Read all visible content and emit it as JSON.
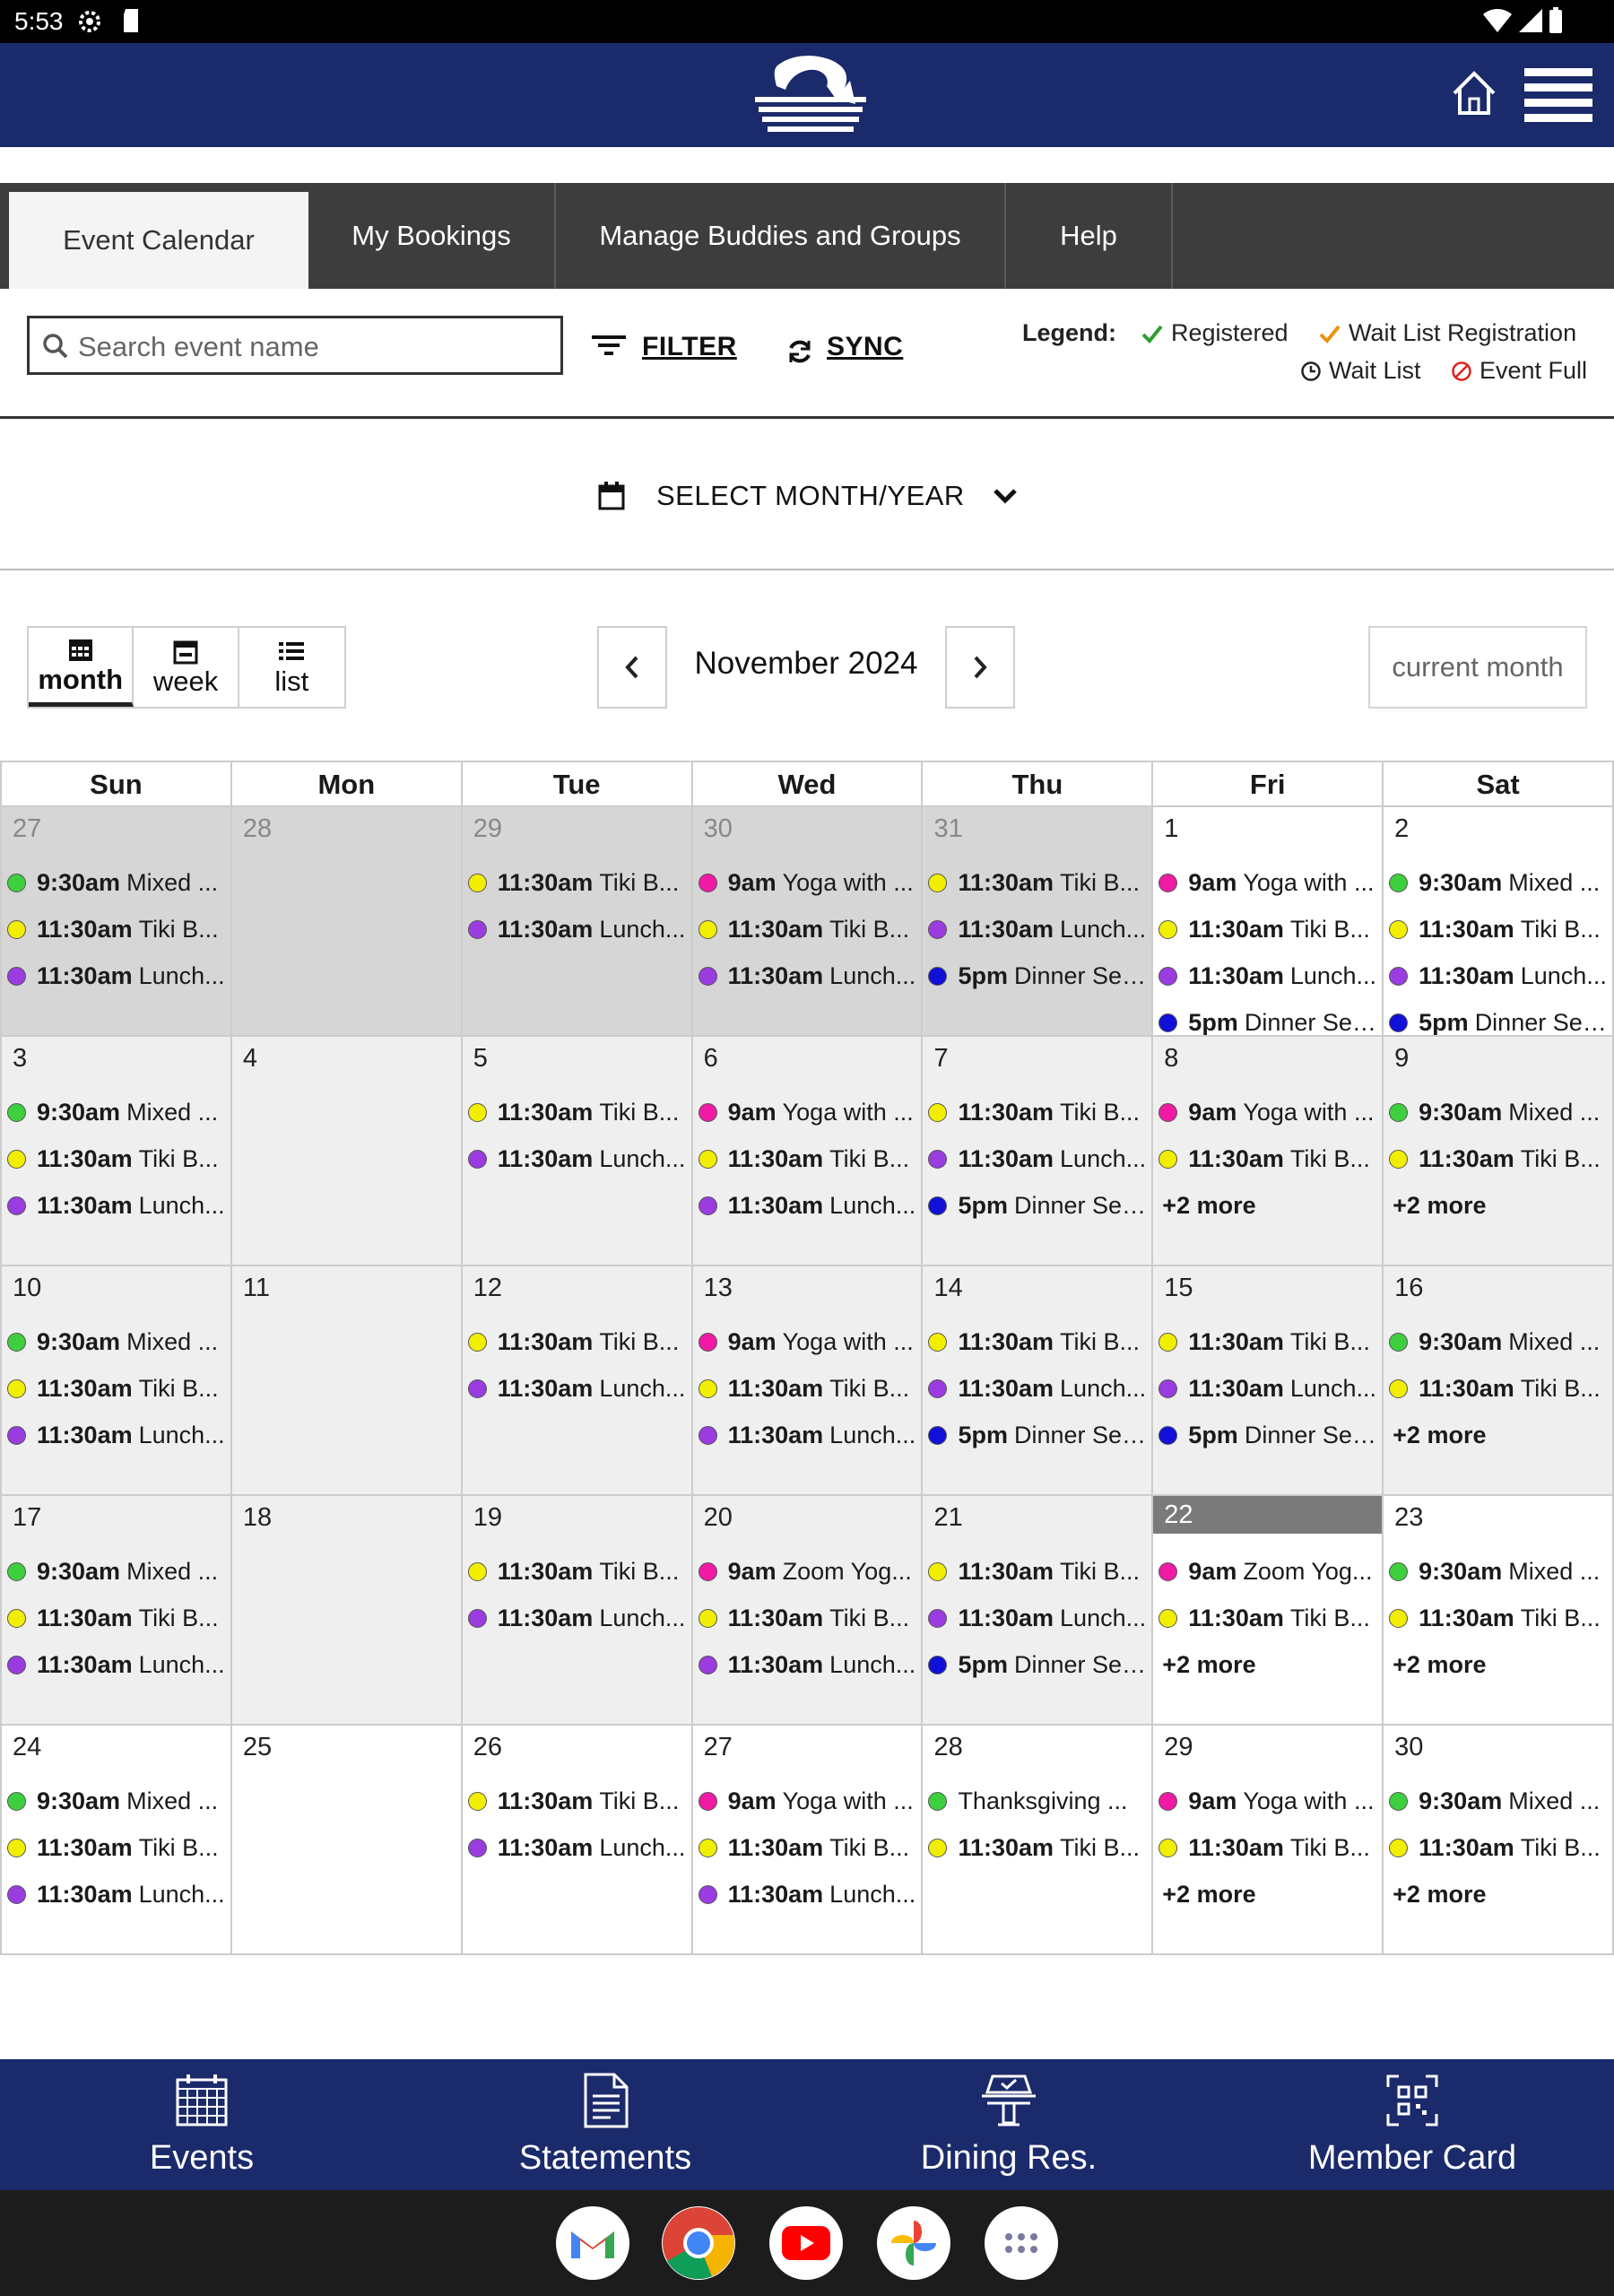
{
  "statusbar": {
    "time": "5:53"
  },
  "colors": {
    "header_bg": "#1b2a6b",
    "tabs_bg": "#3d3d3d",
    "registered": "#2e9e2e",
    "waitlist_reg": "#e89410",
    "event_full": "#e02020"
  },
  "tabs": [
    {
      "label": "Event Calendar",
      "active": true
    },
    {
      "label": "My Bookings"
    },
    {
      "label": "Manage Buddies and Groups"
    },
    {
      "label": "Help"
    }
  ],
  "search": {
    "placeholder": "Search event name"
  },
  "toolbar": {
    "filter_label": "FILTER",
    "sync_label": "SYNC"
  },
  "legend": {
    "label": "Legend:",
    "registered": "Registered",
    "waitlist_registration": "Wait List Registration",
    "waitlist": "Wait List",
    "event_full": "Event Full"
  },
  "select_month": {
    "label": "SELECT MONTH/YEAR"
  },
  "views": {
    "month": "month",
    "week": "week",
    "list": "list"
  },
  "calendar": {
    "title": "November 2024",
    "current_month_label": "current month",
    "weekday_headers": [
      "Sun",
      "Mon",
      "Tue",
      "Wed",
      "Thu",
      "Fri",
      "Sat"
    ],
    "weeks": [
      [
        {
          "day": "27",
          "other": true,
          "events": [
            {
              "c": "#3ecf3e",
              "t": "9:30am",
              "n": "Mixed ..."
            },
            {
              "c": "#f2ee00",
              "t": "11:30am",
              "n": "Tiki B..."
            },
            {
              "c": "#9a3ce0",
              "t": "11:30am",
              "n": "Lunch..."
            }
          ]
        },
        {
          "day": "28",
          "other": true,
          "events": []
        },
        {
          "day": "29",
          "other": true,
          "events": [
            {
              "c": "#f2ee00",
              "t": "11:30am",
              "n": "Tiki B..."
            },
            {
              "c": "#9a3ce0",
              "t": "11:30am",
              "n": "Lunch..."
            }
          ]
        },
        {
          "day": "30",
          "other": true,
          "events": [
            {
              "c": "#f01aa5",
              "t": "9am",
              "n": "Yoga with ..."
            },
            {
              "c": "#f2ee00",
              "t": "11:30am",
              "n": "Tiki B..."
            },
            {
              "c": "#9a3ce0",
              "t": "11:30am",
              "n": "Lunch..."
            }
          ]
        },
        {
          "day": "31",
          "other": true,
          "events": [
            {
              "c": "#f2ee00",
              "t": "11:30am",
              "n": "Tiki B..."
            },
            {
              "c": "#9a3ce0",
              "t": "11:30am",
              "n": "Lunch..."
            },
            {
              "c": "#1010d8",
              "t": "5pm",
              "n": "Dinner Ser..."
            }
          ]
        },
        {
          "day": "1",
          "future": true,
          "events": [
            {
              "c": "#f01aa5",
              "t": "9am",
              "n": "Yoga with ..."
            },
            {
              "c": "#f2ee00",
              "t": "11:30am",
              "n": "Tiki B..."
            },
            {
              "c": "#9a3ce0",
              "t": "11:30am",
              "n": "Lunch..."
            },
            {
              "c": "#1010d8",
              "t": "5pm",
              "n": "Dinner Ser..."
            }
          ]
        },
        {
          "day": "2",
          "future": true,
          "events": [
            {
              "c": "#3ecf3e",
              "t": "9:30am",
              "n": "Mixed ..."
            },
            {
              "c": "#f2ee00",
              "t": "11:30am",
              "n": "Tiki B..."
            },
            {
              "c": "#9a3ce0",
              "t": "11:30am",
              "n": "Lunch..."
            },
            {
              "c": "#1010d8",
              "t": "5pm",
              "n": "Dinner Ser..."
            }
          ]
        }
      ],
      [
        {
          "day": "3",
          "events": [
            {
              "c": "#3ecf3e",
              "t": "9:30am",
              "n": "Mixed ..."
            },
            {
              "c": "#f2ee00",
              "t": "11:30am",
              "n": "Tiki B..."
            },
            {
              "c": "#9a3ce0",
              "t": "11:30am",
              "n": "Lunch..."
            }
          ]
        },
        {
          "day": "4",
          "events": []
        },
        {
          "day": "5",
          "events": [
            {
              "c": "#f2ee00",
              "t": "11:30am",
              "n": "Tiki B..."
            },
            {
              "c": "#9a3ce0",
              "t": "11:30am",
              "n": "Lunch..."
            }
          ]
        },
        {
          "day": "6",
          "events": [
            {
              "c": "#f01aa5",
              "t": "9am",
              "n": "Yoga with ..."
            },
            {
              "c": "#f2ee00",
              "t": "11:30am",
              "n": "Tiki B..."
            },
            {
              "c": "#9a3ce0",
              "t": "11:30am",
              "n": "Lunch..."
            }
          ]
        },
        {
          "day": "7",
          "events": [
            {
              "c": "#f2ee00",
              "t": "11:30am",
              "n": "Tiki B..."
            },
            {
              "c": "#9a3ce0",
              "t": "11:30am",
              "n": "Lunch..."
            },
            {
              "c": "#1010d8",
              "t": "5pm",
              "n": "Dinner Ser..."
            }
          ]
        },
        {
          "day": "8",
          "events": [
            {
              "c": "#f01aa5",
              "t": "9am",
              "n": "Yoga with ..."
            },
            {
              "c": "#f2ee00",
              "t": "11:30am",
              "n": "Tiki B..."
            }
          ],
          "more": "+2 more"
        },
        {
          "day": "9",
          "events": [
            {
              "c": "#3ecf3e",
              "t": "9:30am",
              "n": "Mixed ..."
            },
            {
              "c": "#f2ee00",
              "t": "11:30am",
              "n": "Tiki B..."
            }
          ],
          "more": "+2 more"
        }
      ],
      [
        {
          "day": "10",
          "events": [
            {
              "c": "#3ecf3e",
              "t": "9:30am",
              "n": "Mixed ..."
            },
            {
              "c": "#f2ee00",
              "t": "11:30am",
              "n": "Tiki B..."
            },
            {
              "c": "#9a3ce0",
              "t": "11:30am",
              "n": "Lunch..."
            }
          ]
        },
        {
          "day": "11",
          "events": []
        },
        {
          "day": "12",
          "events": [
            {
              "c": "#f2ee00",
              "t": "11:30am",
              "n": "Tiki B..."
            },
            {
              "c": "#9a3ce0",
              "t": "11:30am",
              "n": "Lunch..."
            }
          ]
        },
        {
          "day": "13",
          "events": [
            {
              "c": "#f01aa5",
              "t": "9am",
              "n": "Yoga with ..."
            },
            {
              "c": "#f2ee00",
              "t": "11:30am",
              "n": "Tiki B..."
            },
            {
              "c": "#9a3ce0",
              "t": "11:30am",
              "n": "Lunch..."
            }
          ]
        },
        {
          "day": "14",
          "events": [
            {
              "c": "#f2ee00",
              "t": "11:30am",
              "n": "Tiki B..."
            },
            {
              "c": "#9a3ce0",
              "t": "11:30am",
              "n": "Lunch..."
            },
            {
              "c": "#1010d8",
              "t": "5pm",
              "n": "Dinner Ser..."
            }
          ]
        },
        {
          "day": "15",
          "events": [
            {
              "c": "#f2ee00",
              "t": "11:30am",
              "n": "Tiki B..."
            },
            {
              "c": "#9a3ce0",
              "t": "11:30am",
              "n": "Lunch..."
            },
            {
              "c": "#1010d8",
              "t": "5pm",
              "n": "Dinner Ser..."
            }
          ]
        },
        {
          "day": "16",
          "events": [
            {
              "c": "#3ecf3e",
              "t": "9:30am",
              "n": "Mixed ..."
            },
            {
              "c": "#f2ee00",
              "t": "11:30am",
              "n": "Tiki B..."
            }
          ],
          "more": "+2 more"
        }
      ],
      [
        {
          "day": "17",
          "events": [
            {
              "c": "#3ecf3e",
              "t": "9:30am",
              "n": "Mixed ..."
            },
            {
              "c": "#f2ee00",
              "t": "11:30am",
              "n": "Tiki B..."
            },
            {
              "c": "#9a3ce0",
              "t": "11:30am",
              "n": "Lunch..."
            }
          ]
        },
        {
          "day": "18",
          "events": []
        },
        {
          "day": "19",
          "events": [
            {
              "c": "#f2ee00",
              "t": "11:30am",
              "n": "Tiki B..."
            },
            {
              "c": "#9a3ce0",
              "t": "11:30am",
              "n": "Lunch..."
            }
          ]
        },
        {
          "day": "20",
          "events": [
            {
              "c": "#f01aa5",
              "t": "9am",
              "n": "Zoom Yog..."
            },
            {
              "c": "#f2ee00",
              "t": "11:30am",
              "n": "Tiki B..."
            },
            {
              "c": "#9a3ce0",
              "t": "11:30am",
              "n": "Lunch..."
            }
          ]
        },
        {
          "day": "21",
          "events": [
            {
              "c": "#f2ee00",
              "t": "11:30am",
              "n": "Tiki B..."
            },
            {
              "c": "#9a3ce0",
              "t": "11:30am",
              "n": "Lunch..."
            },
            {
              "c": "#1010d8",
              "t": "5pm",
              "n": "Dinner Ser..."
            }
          ]
        },
        {
          "day": "22",
          "today": true,
          "future": true,
          "events": [
            {
              "c": "#f01aa5",
              "t": "9am",
              "n": "Zoom Yog..."
            },
            {
              "c": "#f2ee00",
              "t": "11:30am",
              "n": "Tiki B..."
            }
          ],
          "more": "+2 more"
        },
        {
          "day": "23",
          "future": true,
          "events": [
            {
              "c": "#3ecf3e",
              "t": "9:30am",
              "n": "Mixed ..."
            },
            {
              "c": "#f2ee00",
              "t": "11:30am",
              "n": "Tiki B..."
            }
          ],
          "more": "+2 more"
        }
      ],
      [
        {
          "day": "24",
          "future": true,
          "events": [
            {
              "c": "#3ecf3e",
              "t": "9:30am",
              "n": "Mixed ..."
            },
            {
              "c": "#f2ee00",
              "t": "11:30am",
              "n": "Tiki B..."
            },
            {
              "c": "#9a3ce0",
              "t": "11:30am",
              "n": "Lunch..."
            }
          ]
        },
        {
          "day": "25",
          "future": true,
          "events": []
        },
        {
          "day": "26",
          "future": true,
          "events": [
            {
              "c": "#f2ee00",
              "t": "11:30am",
              "n": "Tiki B..."
            },
            {
              "c": "#9a3ce0",
              "t": "11:30am",
              "n": "Lunch..."
            }
          ]
        },
        {
          "day": "27",
          "future": true,
          "events": [
            {
              "c": "#f01aa5",
              "t": "9am",
              "n": "Yoga with ..."
            },
            {
              "c": "#f2ee00",
              "t": "11:30am",
              "n": "Tiki B..."
            },
            {
              "c": "#9a3ce0",
              "t": "11:30am",
              "n": "Lunch..."
            }
          ]
        },
        {
          "day": "28",
          "future": true,
          "events": [
            {
              "c": "#3ecf3e",
              "t": "",
              "n": "Thanksgiving ..."
            },
            {
              "c": "#f2ee00",
              "t": "11:30am",
              "n": "Tiki B..."
            }
          ]
        },
        {
          "day": "29",
          "future": true,
          "events": [
            {
              "c": "#f01aa5",
              "t": "9am",
              "n": "Yoga with ..."
            },
            {
              "c": "#f2ee00",
              "t": "11:30am",
              "n": "Tiki B..."
            }
          ],
          "more": "+2 more"
        },
        {
          "day": "30",
          "future": true,
          "events": [
            {
              "c": "#3ecf3e",
              "t": "9:30am",
              "n": "Mixed ..."
            },
            {
              "c": "#f2ee00",
              "t": "11:30am",
              "n": "Tiki B..."
            }
          ],
          "more": "+2 more"
        }
      ]
    ]
  },
  "bottom_nav": [
    {
      "label": "Events",
      "icon": "calendar-grid-icon"
    },
    {
      "label": "Statements",
      "icon": "document-icon"
    },
    {
      "label": "Dining Res.",
      "icon": "dining-icon"
    },
    {
      "label": "Member Card",
      "icon": "qr-card-icon"
    }
  ],
  "dock": [
    "gmail-icon",
    "chrome-icon",
    "youtube-icon",
    "photos-icon",
    "app-drawer-icon"
  ]
}
